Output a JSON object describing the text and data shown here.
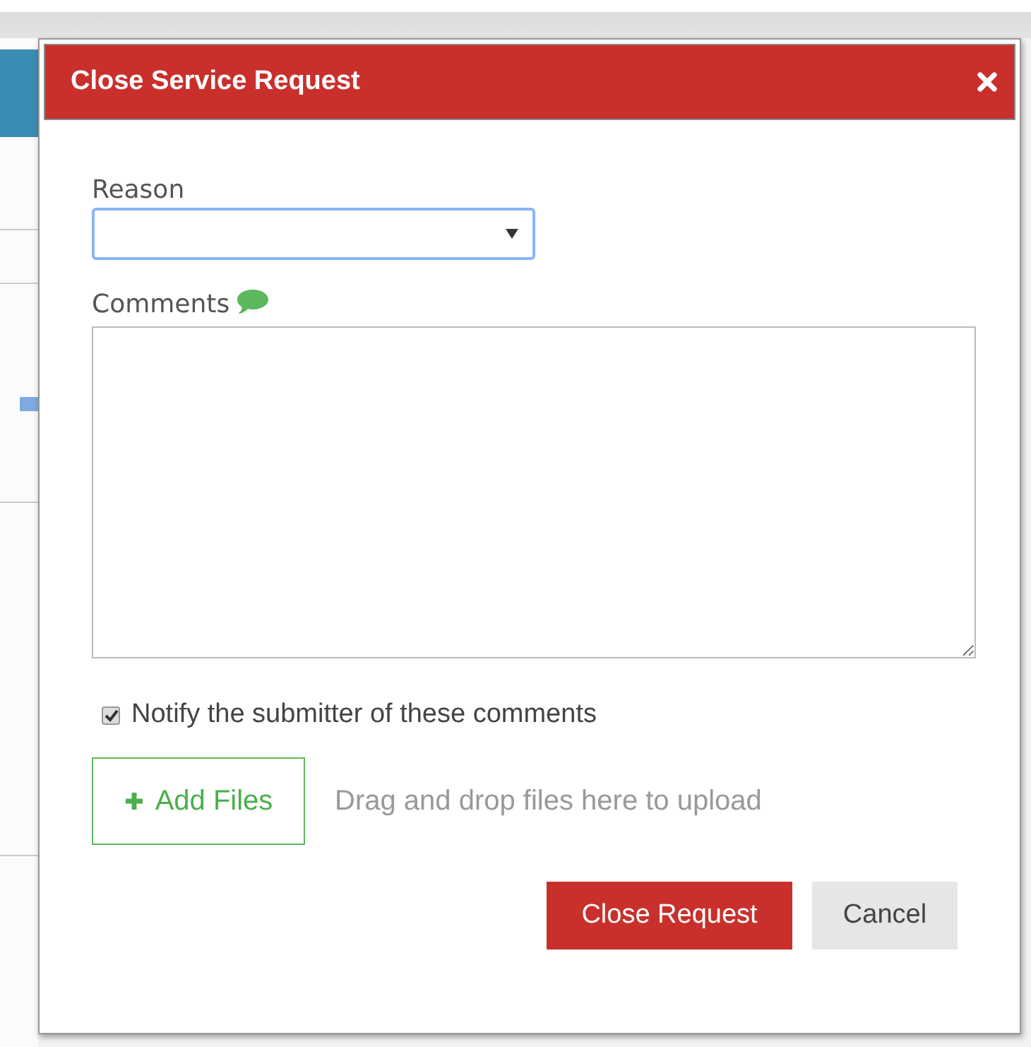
{
  "dialog": {
    "title": "Close Service Request"
  },
  "reason": {
    "label": "Reason",
    "focused": true
  },
  "comments": {
    "label": "Comments"
  },
  "notify": {
    "label": "Notify the submitter of these comments",
    "checked": true
  },
  "upload": {
    "button": "Add Files",
    "hint": "Drag and drop files here to upload"
  },
  "buttons": [
    {
      "label": "Close Request",
      "kind": "primary"
    },
    {
      "label": "Cancel",
      "kind": "secondary"
    }
  ]
}
